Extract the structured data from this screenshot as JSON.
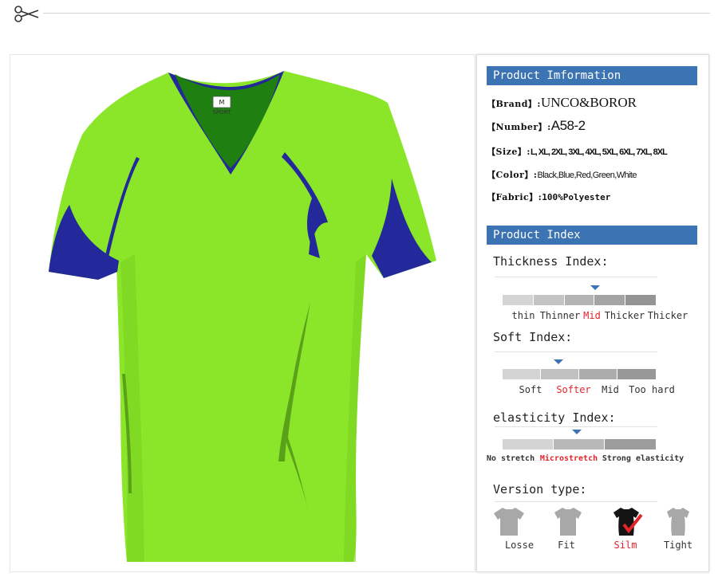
{
  "colors": {
    "accent_blue": "#3c73b2",
    "highlight_red": "#e2242b",
    "shirt_green": "#8be62a",
    "shirt_navy": "#23289a"
  },
  "decor": {
    "scissors_icon": "scissors-icon"
  },
  "product_image": {
    "collar_label_brand": "M",
    "collar_label_text": "SPORT"
  },
  "product_information": {
    "header": "Product Imformation",
    "rows": [
      {
        "key": "【Brand】:",
        "value": "UNCO&BOROR"
      },
      {
        "key": "【Number】:",
        "value": "A58-2"
      },
      {
        "key": "【Size】:",
        "value": "L, XL, 2XL, 3XL, 4XL, 5XL, 6XL, 7XL, 8XL"
      },
      {
        "key": "【Color】:",
        "value": "Black,Blue,Red,Green,White"
      },
      {
        "key": "【Fabric】:",
        "value": "100%Polyester"
      }
    ]
  },
  "product_index": {
    "header": "Product Index",
    "thickness": {
      "title": "Thickness Index:",
      "labels": [
        "thin",
        "Thinner",
        "Mid",
        "Thicker",
        "Thicker"
      ],
      "selected": "Mid"
    },
    "soft": {
      "title": "Soft Index:",
      "labels": [
        "Soft",
        "Softer",
        "Mid",
        "Too hard"
      ],
      "selected": "Softer"
    },
    "elasticity": {
      "title": "elasticity Index:",
      "labels": [
        "No stretch",
        "Microstretch",
        "Strong elasticity"
      ],
      "selected": "Microstretch"
    },
    "version": {
      "title": "Version type:",
      "labels": [
        "Losse",
        "Fit",
        "Silm",
        "Tight"
      ],
      "selected": "Silm"
    }
  }
}
